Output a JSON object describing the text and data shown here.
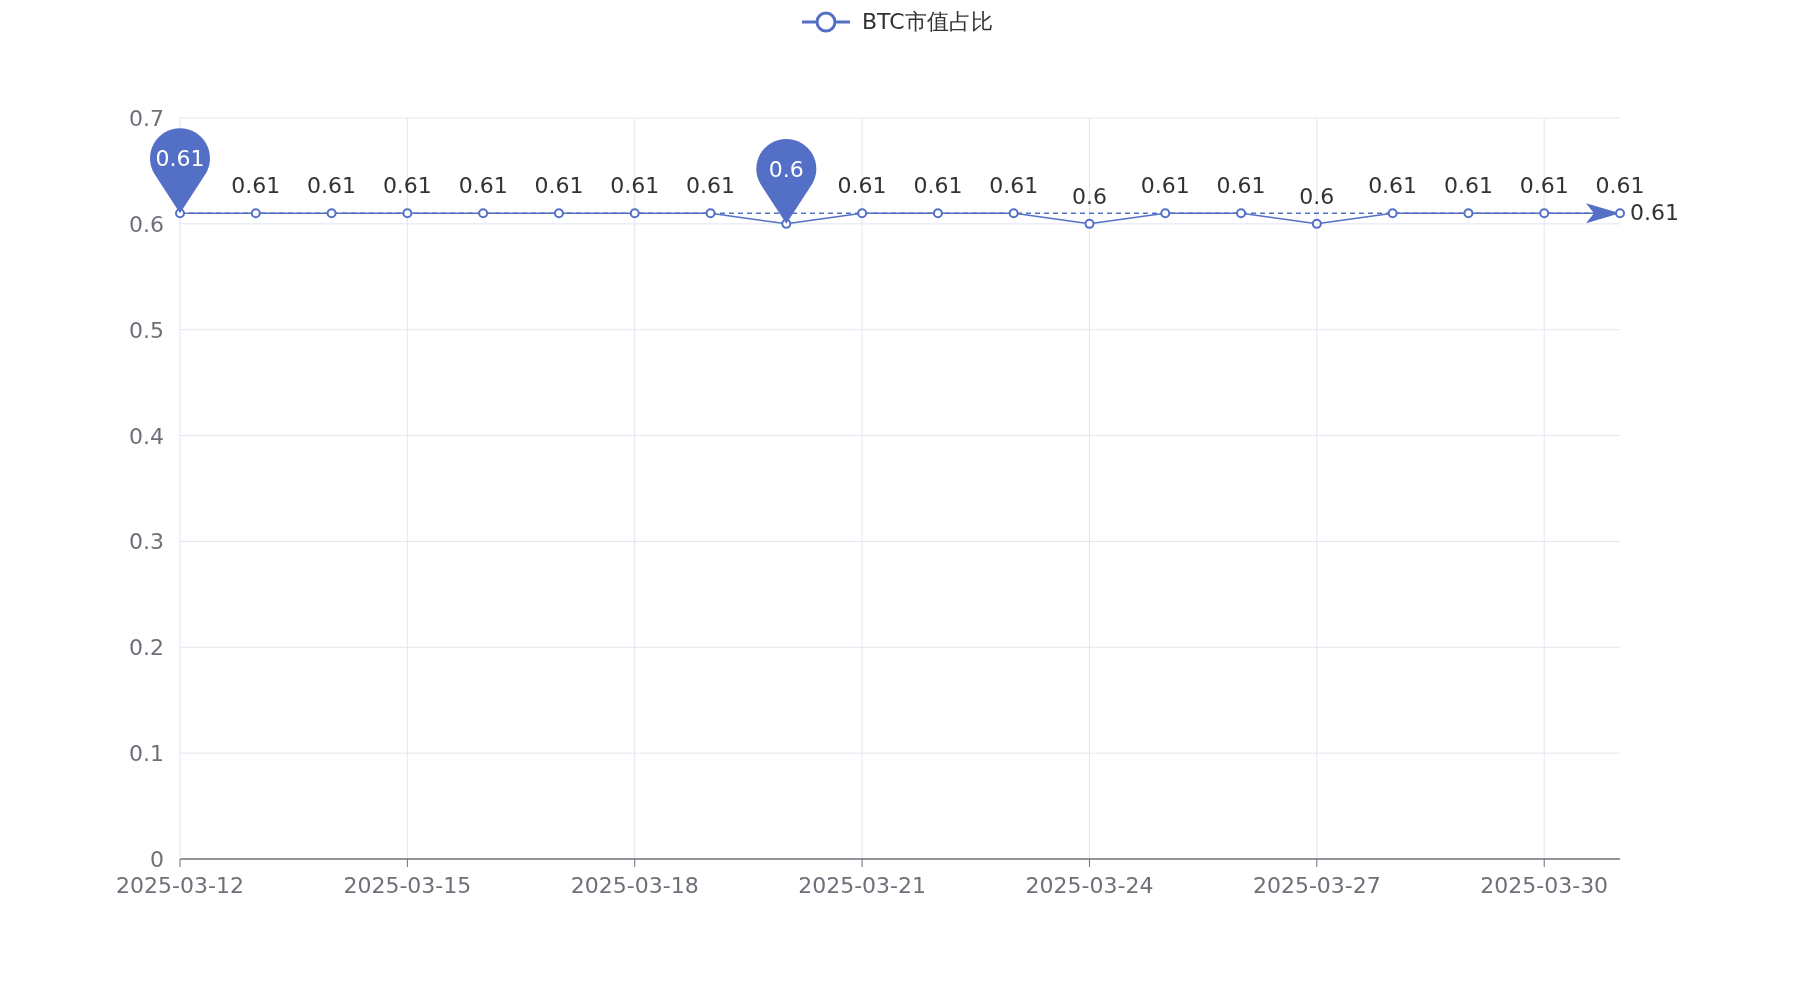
{
  "chart": {
    "chart_data": {
      "type": "line",
      "x": [
        "2025-03-12",
        "2025-03-13",
        "2025-03-14",
        "2025-03-15",
        "2025-03-16",
        "2025-03-17",
        "2025-03-18",
        "2025-03-19",
        "2025-03-20",
        "2025-03-21",
        "2025-03-22",
        "2025-03-23",
        "2025-03-24",
        "2025-03-25",
        "2025-03-26",
        "2025-03-27",
        "2025-03-28",
        "2025-03-29",
        "2025-03-30",
        "2025-03-31"
      ],
      "series": [
        {
          "name": "BTC市值占比",
          "color": "#5470c6",
          "marker": "circle",
          "values": [
            0.61,
            0.61,
            0.61,
            0.61,
            0.61,
            0.61,
            0.61,
            0.61,
            0.6,
            0.61,
            0.61,
            0.61,
            0.6,
            0.61,
            0.61,
            0.6,
            0.61,
            0.61,
            0.61,
            0.61
          ]
        }
      ],
      "xlim": [
        "2025-03-12",
        "2025-03-31"
      ],
      "ylim": [
        0,
        0.7
      ],
      "yticks": [
        0,
        0.1,
        0.2,
        0.3,
        0.4,
        0.5,
        0.6,
        0.7
      ],
      "xticks": [
        "2025-03-12",
        "2025-03-15",
        "2025-03-18",
        "2025-03-21",
        "2025-03-24",
        "2025-03-27",
        "2025-03-30"
      ],
      "grid": true,
      "value_labels": [
        null,
        "0.61",
        "0.61",
        "0.61",
        "0.61",
        "0.61",
        "0.61",
        "0.61",
        null,
        "0.61",
        "0.61",
        "0.61",
        "0.6",
        "0.61",
        "0.61",
        "0.6",
        "0.61",
        "0.61",
        "0.61",
        "0.61"
      ],
      "annotations": [
        {
          "text": "0.61",
          "x": "2025-03-12",
          "y": 0.61
        },
        {
          "text": "0.6",
          "x": "2025-03-20",
          "y": 0.6
        }
      ],
      "ref_lines": [
        {
          "axis": "y",
          "value": 0.61,
          "label": "0.61"
        }
      ]
    }
  }
}
